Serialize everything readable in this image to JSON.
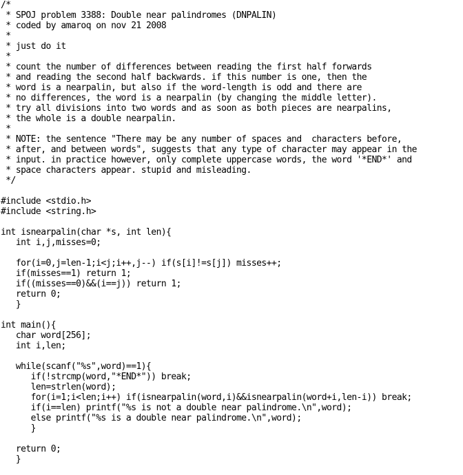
{
  "document": {
    "lines": [
      "/*",
      " * SPOJ problem 3388: Double near palindromes (DNPALIN)",
      " * coded by amaroq on nov 21 2008",
      " *",
      " * just do it",
      " *",
      " * count the number of differences between reading the first half forwards",
      " * and reading the second half backwards. if this number is one, then the",
      " * word is a nearpalin, but also if the word-length is odd and there are",
      " * no differences, the word is a nearpalin (by changing the middle letter).",
      " * try all divisions into two words and as soon as both pieces are nearpalins,",
      " * the whole is a double nearpalin.",
      " *",
      " * NOTE: the sentence \"There may be any number of spaces and  characters before,",
      " * after, and between words\", suggests that any type of character may appear in the",
      " * input. in practice however, only complete uppercase words, the word '*END*' and",
      " * space characters appear. stupid and misleading.",
      " */",
      "",
      "#include <stdio.h>",
      "#include <string.h>",
      "",
      "int isnearpalin(char *s, int len){",
      "   int i,j,misses=0;",
      "",
      "   for(i=0,j=len-1;i<j;i++,j--) if(s[i]!=s[j]) misses++;",
      "   if(misses==1) return 1;",
      "   if((misses==0)&&(i==j)) return 1;",
      "   return 0;",
      "   }",
      "",
      "int main(){",
      "   char word[256];",
      "   int i,len;",
      "",
      "   while(scanf(\"%s\",word)==1){",
      "      if(!strcmp(word,\"*END*\")) break;",
      "      len=strlen(word);",
      "      for(i=1;i<len;i++) if(isnearpalin(word,i)&&isnearpalin(word+i,len-i)) break;",
      "      if(i==len) printf(\"%s is not a double near palindrome.\\n\",word);",
      "      else printf(\"%s is a double near palindrome.\\n\",word);",
      "      }",
      "",
      "   return 0;",
      "   }"
    ]
  }
}
